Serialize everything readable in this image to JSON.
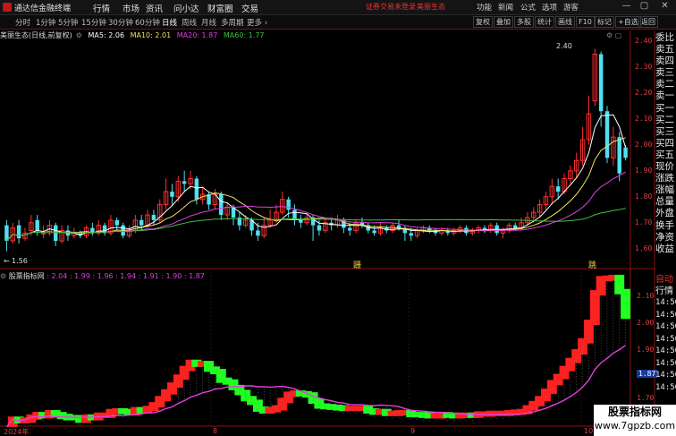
{
  "app": {
    "title": "通达信金融终端",
    "menus": [
      "行情",
      "市场",
      "资讯",
      "问小达",
      "财富圈",
      "交易"
    ],
    "notice_trade": "证券交易未登录",
    "notice_stock": "美丽生态",
    "right_menus": [
      "功能",
      "新闻",
      "公式",
      "选项",
      "游客"
    ],
    "window_controls": [
      "—",
      "▢",
      "✕"
    ]
  },
  "toolbar": {
    "periods": [
      "分时",
      "1分钟",
      "5分钟",
      "15分钟",
      "30分钟",
      "60分钟",
      "日线",
      "周线",
      "月线",
      "多周期",
      "更多 ›"
    ],
    "active_period": "日线",
    "right_tools": [
      "复权",
      "叠加",
      "多股",
      "统计",
      "画线",
      "F10",
      "标记",
      "+自选",
      "返回"
    ]
  },
  "kline_info": {
    "stock": "美丽生态(日线,前复权)",
    "ma5": "MA5: 2.06",
    "ma10": "MA10: 2.01",
    "ma20": "MA20: 1.87",
    "ma60": "MA60: 1.77"
  },
  "main_yaxis": [
    "2.40",
    "2.30",
    "2.20",
    "2.10",
    "2.00",
    "1.90",
    "1.80",
    "1.70",
    "1.60"
  ],
  "annotations": {
    "high": "2.40",
    "low": "1.56",
    "mark1": "跚",
    "mark2": "跳"
  },
  "indicator": {
    "title": "股票指标网",
    "values": ": 2.04 : 1.99 : 1.96 : 1.94 : 1.91 : 1.90 : 1.87",
    "current": "1.87"
  },
  "ind_yaxis": [
    "2.10",
    "2.00",
    "1.90",
    "1.80",
    "1.70"
  ],
  "xaxis": {
    "start": "2024年",
    "m1": "8",
    "m2": "9",
    "m3": "10"
  },
  "side_panel": [
    "委比",
    "卖五",
    "卖四",
    "卖三",
    "卖二",
    "卖一",
    "买一",
    "买二",
    "买三",
    "买四",
    "买五",
    "现价",
    "涨跌",
    "涨幅",
    "总量",
    "外盘",
    "换手",
    "净资",
    "收益"
  ],
  "side_panel2": [
    "自动",
    "行情"
  ],
  "side_times": [
    "14:56",
    "14:56",
    "14:56",
    "14:56",
    "14:56",
    "14:56",
    "14:56",
    "14:56"
  ],
  "watermark": {
    "line1": "股票指标网",
    "line2": "www.7gpzb.com"
  },
  "colors": {
    "up": "#ff3030",
    "down": "#50e0f0",
    "ma5": "#ffffff",
    "ma10": "#f0e060",
    "ma20": "#e040e0",
    "ma60": "#40c040",
    "ind_up": "#ff2020",
    "ind_down": "#20ff20",
    "ind_line": "#e040e0"
  },
  "chart_data": {
    "type": "candlestick",
    "ylim": [
      1.56,
      2.43
    ],
    "candles": [
      [
        1.72,
        1.66,
        1.74,
        1.62
      ],
      [
        1.66,
        1.71,
        1.73,
        1.65
      ],
      [
        1.72,
        1.67,
        1.74,
        1.65
      ],
      [
        1.67,
        1.69,
        1.71,
        1.66
      ],
      [
        1.7,
        1.73,
        1.76,
        1.68
      ],
      [
        1.74,
        1.7,
        1.76,
        1.68
      ],
      [
        1.69,
        1.69,
        1.72,
        1.67
      ],
      [
        1.69,
        1.72,
        1.74,
        1.68
      ],
      [
        1.72,
        1.66,
        1.73,
        1.64
      ],
      [
        1.66,
        1.7,
        1.72,
        1.65
      ],
      [
        1.7,
        1.68,
        1.72,
        1.66
      ],
      [
        1.68,
        1.69,
        1.71,
        1.67
      ],
      [
        1.69,
        1.68,
        1.7,
        1.67
      ],
      [
        1.68,
        1.71,
        1.72,
        1.67
      ],
      [
        1.71,
        1.69,
        1.73,
        1.68
      ],
      [
        1.69,
        1.72,
        1.74,
        1.68
      ],
      [
        1.72,
        1.69,
        1.73,
        1.68
      ],
      [
        1.69,
        1.74,
        1.76,
        1.68
      ],
      [
        1.74,
        1.72,
        1.75,
        1.7
      ],
      [
        1.72,
        1.68,
        1.73,
        1.67
      ],
      [
        1.68,
        1.7,
        1.72,
        1.67
      ],
      [
        1.7,
        1.74,
        1.76,
        1.69
      ],
      [
        1.74,
        1.72,
        1.76,
        1.7
      ],
      [
        1.72,
        1.76,
        1.78,
        1.71
      ],
      [
        1.76,
        1.74,
        1.78,
        1.72
      ],
      [
        1.74,
        1.8,
        1.82,
        1.73
      ],
      [
        1.8,
        1.85,
        1.9,
        1.78
      ],
      [
        1.85,
        1.83,
        1.88,
        1.8
      ],
      [
        1.83,
        1.89,
        1.91,
        1.81
      ],
      [
        1.89,
        1.88,
        1.93,
        1.85
      ],
      [
        1.88,
        1.9,
        1.93,
        1.86
      ],
      [
        1.9,
        1.82,
        1.91,
        1.8
      ],
      [
        1.82,
        1.84,
        1.87,
        1.8
      ],
      [
        1.84,
        1.8,
        1.85,
        1.78
      ],
      [
        1.8,
        1.84,
        1.86,
        1.78
      ],
      [
        1.84,
        1.76,
        1.85,
        1.74
      ],
      [
        1.76,
        1.79,
        1.81,
        1.74
      ],
      [
        1.79,
        1.75,
        1.8,
        1.72
      ],
      [
        1.75,
        1.72,
        1.77,
        1.7
      ],
      [
        1.72,
        1.74,
        1.76,
        1.71
      ],
      [
        1.74,
        1.7,
        1.75,
        1.68
      ],
      [
        1.7,
        1.68,
        1.73,
        1.66
      ],
      [
        1.68,
        1.72,
        1.75,
        1.67
      ],
      [
        1.72,
        1.74,
        1.78,
        1.71
      ],
      [
        1.74,
        1.77,
        1.8,
        1.73
      ],
      [
        1.77,
        1.82,
        1.85,
        1.76
      ],
      [
        1.82,
        1.78,
        1.83,
        1.75
      ],
      [
        1.78,
        1.74,
        1.8,
        1.72
      ],
      [
        1.74,
        1.73,
        1.76,
        1.71
      ],
      [
        1.73,
        1.75,
        1.77,
        1.72
      ],
      [
        1.75,
        1.72,
        1.76,
        1.66
      ],
      [
        1.72,
        1.7,
        1.74,
        1.68
      ],
      [
        1.7,
        1.73,
        1.75,
        1.69
      ],
      [
        1.73,
        1.72,
        1.75,
        1.7
      ],
      [
        1.72,
        1.74,
        1.76,
        1.71
      ],
      [
        1.74,
        1.71,
        1.75,
        1.69
      ],
      [
        1.71,
        1.7,
        1.73,
        1.68
      ],
      [
        1.7,
        1.73,
        1.74,
        1.69
      ],
      [
        1.73,
        1.72,
        1.75,
        1.71
      ],
      [
        1.72,
        1.7,
        1.73,
        1.69
      ],
      [
        1.7,
        1.69,
        1.72,
        1.68
      ],
      [
        1.69,
        1.71,
        1.73,
        1.68
      ],
      [
        1.71,
        1.7,
        1.72,
        1.69
      ],
      [
        1.7,
        1.72,
        1.73,
        1.69
      ],
      [
        1.72,
        1.71,
        1.74,
        1.7
      ],
      [
        1.71,
        1.69,
        1.72,
        1.66
      ],
      [
        1.69,
        1.68,
        1.71,
        1.66
      ],
      [
        1.68,
        1.7,
        1.71,
        1.67
      ],
      [
        1.7,
        1.71,
        1.72,
        1.69
      ],
      [
        1.71,
        1.7,
        1.72,
        1.69
      ],
      [
        1.7,
        1.69,
        1.71,
        1.68
      ],
      [
        1.69,
        1.7,
        1.71,
        1.68
      ],
      [
        1.7,
        1.69,
        1.71,
        1.68
      ],
      [
        1.69,
        1.7,
        1.71,
        1.68
      ],
      [
        1.7,
        1.71,
        1.72,
        1.69
      ],
      [
        1.71,
        1.69,
        1.72,
        1.68
      ],
      [
        1.69,
        1.7,
        1.71,
        1.68
      ],
      [
        1.7,
        1.71,
        1.72,
        1.69
      ],
      [
        1.71,
        1.7,
        1.72,
        1.69
      ],
      [
        1.7,
        1.72,
        1.73,
        1.69
      ],
      [
        1.72,
        1.69,
        1.73,
        1.68
      ],
      [
        1.69,
        1.7,
        1.71,
        1.67
      ],
      [
        1.7,
        1.72,
        1.73,
        1.69
      ],
      [
        1.72,
        1.71,
        1.73,
        1.7
      ],
      [
        1.71,
        1.73,
        1.75,
        1.7
      ],
      [
        1.73,
        1.75,
        1.77,
        1.72
      ],
      [
        1.75,
        1.77,
        1.79,
        1.73
      ],
      [
        1.77,
        1.8,
        1.82,
        1.75
      ],
      [
        1.8,
        1.83,
        1.85,
        1.78
      ],
      [
        1.83,
        1.87,
        1.9,
        1.8
      ],
      [
        1.87,
        1.85,
        1.9,
        1.82
      ],
      [
        1.85,
        1.9,
        1.92,
        1.84
      ],
      [
        1.9,
        1.93,
        1.95,
        1.88
      ],
      [
        1.93,
        1.97,
        2.0,
        1.9
      ],
      [
        1.97,
        2.05,
        2.1,
        1.95
      ],
      [
        2.05,
        2.15,
        2.22,
        2.03
      ],
      [
        2.2,
        2.38,
        2.4,
        2.18
      ],
      [
        2.38,
        2.16,
        2.39,
        2.1
      ],
      [
        2.16,
        1.98,
        2.18,
        1.96
      ],
      [
        1.98,
        2.06,
        2.1,
        1.95
      ],
      [
        2.06,
        1.92,
        2.08,
        1.89
      ],
      [
        2.02,
        1.98,
        2.03,
        1.97
      ]
    ]
  }
}
